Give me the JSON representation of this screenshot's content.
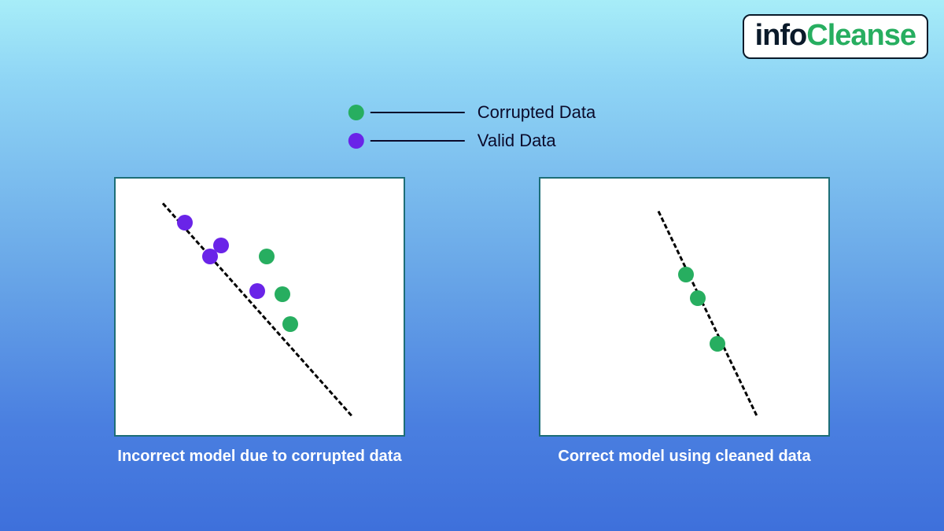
{
  "brand": {
    "part1": "info",
    "part2": "Cleanse"
  },
  "legend": {
    "items": [
      {
        "label": "Corrupted Data",
        "colorClass": "green-dot"
      },
      {
        "label": "Valid Data",
        "colorClass": "purple-dot"
      }
    ]
  },
  "colors": {
    "corrupted": "#27ae60",
    "valid": "#6a24e8",
    "trend": "#000000",
    "panelBorder": "#1d6e77"
  },
  "chart_data": [
    {
      "type": "scatter",
      "title": "Incorrect model due to corrupted data",
      "xlim": [
        0,
        370
      ],
      "ylim": [
        0,
        330
      ],
      "series": [
        {
          "name": "Valid Data",
          "color": "#6a24e8",
          "points": [
            {
              "x": 88,
              "y": 274
            },
            {
              "x": 120,
              "y": 231
            },
            {
              "x": 134,
              "y": 245
            },
            {
              "x": 180,
              "y": 187
            }
          ]
        },
        {
          "name": "Corrupted Data",
          "color": "#27ae60",
          "points": [
            {
              "x": 192,
              "y": 231
            },
            {
              "x": 212,
              "y": 183
            },
            {
              "x": 222,
              "y": 145
            }
          ]
        }
      ],
      "trend": {
        "x1": 60,
        "y1": 300,
        "x2": 300,
        "y2": 30,
        "dashed": true
      }
    },
    {
      "type": "scatter",
      "title": "Correct model using cleaned data",
      "xlim": [
        0,
        370
      ],
      "ylim": [
        0,
        330
      ],
      "series": [
        {
          "name": "Corrupted Data",
          "color": "#27ae60",
          "points": [
            {
              "x": 185,
              "y": 208
            },
            {
              "x": 200,
              "y": 178
            },
            {
              "x": 225,
              "y": 120
            }
          ]
        }
      ],
      "trend": {
        "x1": 150,
        "y1": 290,
        "x2": 275,
        "y2": 30,
        "dashed": true
      }
    }
  ]
}
